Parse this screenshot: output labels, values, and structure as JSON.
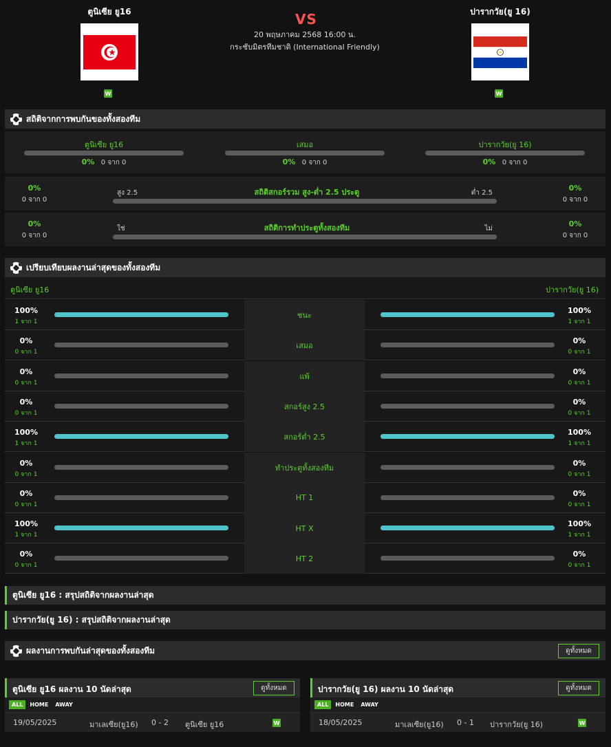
{
  "header": {
    "home_team": "ตูนิเซีย ยู16",
    "away_team": "ปารากวัย(ยู 16)",
    "vs": "VS",
    "datetime": "20 พฤษภาคม 2568 16:00 น.",
    "competition": "กระชับมิตรทีมชาติ (International Friendly)",
    "home_form": "W",
    "away_form": "W"
  },
  "h2h": {
    "title": "สถิติจากการพบกันของทั้งสองทีม",
    "cols": [
      {
        "label": "ตูนิเซีย ยู16",
        "pct": "0%",
        "of": "0 จาก 0"
      },
      {
        "label": "เสมอ",
        "pct": "0%",
        "of": "0 จาก 0"
      },
      {
        "label": "ปารากวัย(ยู 16)",
        "pct": "0%",
        "of": "0 จาก 0"
      }
    ],
    "ou": {
      "title": "สถิติสกอร์รวม สูง-ต่ำ 2.5 ประตู",
      "left_label": "สูง 2.5",
      "right_label": "ต่ำ 2.5",
      "left_pct": "0%",
      "left_of": "0 จาก 0",
      "right_pct": "0%",
      "right_of": "0 จาก 0"
    },
    "btts": {
      "title": "สถิติการทำประตูทั้งสองทีม",
      "left_label": "ใช่",
      "right_label": "ไม่",
      "left_pct": "0%",
      "left_of": "0 จาก 0",
      "right_pct": "0%",
      "right_of": "0 จาก 0"
    }
  },
  "compare": {
    "title": "เปรียบเทียบผลงานล่าสุดของทั้งสองทีม",
    "home_label": "ตูนิเซีย ยู16",
    "away_label": "ปารากวัย(ยู 16)",
    "rows": [
      {
        "label": "ชนะ",
        "home_pct": "100%",
        "home_of": "1 จาก 1",
        "home_val": 1.0,
        "away_pct": "100%",
        "away_of": "1 จาก 1",
        "away_val": 1.0
      },
      {
        "label": "เสมอ",
        "home_pct": "0%",
        "home_of": "0 จาก 1",
        "home_val": 0,
        "away_pct": "0%",
        "away_of": "0 จาก 1",
        "away_val": 0
      },
      {
        "label": "แพ้",
        "home_pct": "0%",
        "home_of": "0 จาก 1",
        "home_val": 0,
        "away_pct": "0%",
        "away_of": "0 จาก 1",
        "away_val": 0
      },
      {
        "label": "สกอร์สูง 2.5",
        "home_pct": "0%",
        "home_of": "0 จาก 1",
        "home_val": 0,
        "away_pct": "0%",
        "away_of": "0 จาก 1",
        "away_val": 0
      },
      {
        "label": "สกอร์ต่ำ 2.5",
        "home_pct": "100%",
        "home_of": "1 จาก 1",
        "home_val": 1.0,
        "away_pct": "100%",
        "away_of": "1 จาก 1",
        "away_val": 1.0
      },
      {
        "label": "ทำประตูทั้งสองทีม",
        "home_pct": "0%",
        "home_of": "0 จาก 1",
        "home_val": 0,
        "away_pct": "0%",
        "away_of": "0 จาก 1",
        "away_val": 0
      },
      {
        "label": "HT 1",
        "home_pct": "0%",
        "home_of": "0 จาก 1",
        "home_val": 0,
        "away_pct": "0%",
        "away_of": "0 จาก 1",
        "away_val": 0
      },
      {
        "label": "HT X",
        "home_pct": "100%",
        "home_of": "1 จาก 1",
        "home_val": 1.0,
        "away_pct": "100%",
        "away_of": "1 จาก 1",
        "away_val": 1.0
      },
      {
        "label": "HT 2",
        "home_pct": "0%",
        "home_of": "0 จาก 1",
        "home_val": 0,
        "away_pct": "0%",
        "away_of": "0 จาก 1",
        "away_val": 0
      }
    ]
  },
  "summary": {
    "home": "ตูนิเซีย ยู16 : สรุปสถิติจากผลงานล่าสุด",
    "away": "ปารากวัย(ยู 16) : สรุปสถิติจากผลงานล่าสุด"
  },
  "recent_h2h": {
    "title": "ผลงานการพบกันล่าสุดของทั้งสองทีม",
    "view_all": "ดูทั้งหมด"
  },
  "last10": {
    "home": {
      "title": "ตูนิเซีย ยู16 ผลงาน 10 นัดล่าสุด",
      "view_all": "ดูทั้งหมด",
      "tabs": [
        "ALL",
        "HOME",
        "AWAY"
      ],
      "match": {
        "date": "19/05/2025",
        "home": "มาเลเซีย(ยู16)",
        "score": "0 - 2",
        "away": "ตูนิเซีย ยู16",
        "result": "W"
      }
    },
    "away": {
      "title": "ปารากวัย(ยู 16) ผลงาน 10 นัดล่าสุด",
      "view_all": "ดูทั้งหมด",
      "tabs": [
        "ALL",
        "HOME",
        "AWAY"
      ],
      "match": {
        "date": "18/05/2025",
        "home": "มาเลเซีย(ยู16)",
        "score": "0 - 1",
        "away": "ปารากวัย(ยู 16)",
        "result": "W"
      }
    }
  },
  "colors": {
    "accent": "#5bd12a",
    "bar_fill": "#4fc3c9",
    "vs": "#ff5252"
  }
}
